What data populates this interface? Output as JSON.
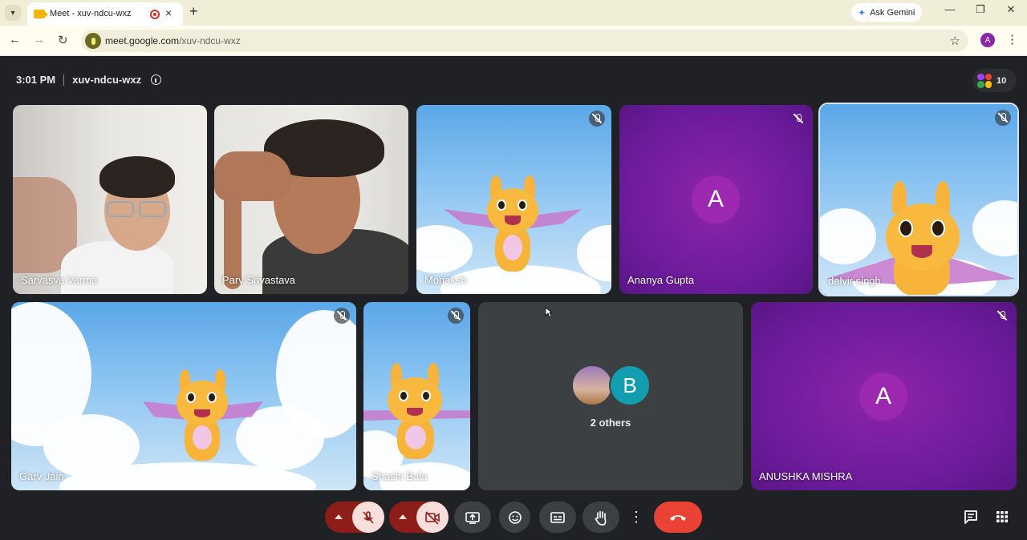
{
  "browser": {
    "tab_title": "Meet - xuv-ndcu-wxz",
    "new_tab": "+",
    "ask_gemini": "Ask Gemini",
    "url_host": "meet.google.com",
    "url_path": "/xuv-ndcu-wxz",
    "profile_initial": "A",
    "window_controls": [
      "—",
      "❐",
      "✕"
    ]
  },
  "meeting": {
    "time": "3:01 PM",
    "code": "xuv-ndcu-wxz",
    "participant_count": "10"
  },
  "tiles": [
    {
      "name": "Sarvasva Varma",
      "type": "camera",
      "muted": false
    },
    {
      "name": "Parv Srivastava",
      "type": "camera",
      "muted": false
    },
    {
      "name": "Monaksh",
      "type": "avatar-dragon",
      "muted": true
    },
    {
      "name": "Ananya Gupta",
      "type": "initial",
      "initial": "A",
      "muted": true
    },
    {
      "name": "dalvir singh",
      "type": "avatar-dragon",
      "muted": true
    },
    {
      "name": "Garv Jain",
      "type": "avatar-dragon",
      "muted": true
    },
    {
      "name": "Shashi Bala",
      "type": "avatar-dragon",
      "muted": true
    },
    {
      "name": "",
      "type": "others",
      "label": "2 others",
      "initial": "B"
    },
    {
      "name": "ANUSHKA MISHRA",
      "type": "initial",
      "initial": "A",
      "muted": true
    }
  ],
  "controls": [
    "mic-options",
    "microphone-off",
    "camera-options",
    "camera-off",
    "present-screen",
    "emoji-reactions",
    "captions",
    "raise-hand",
    "more-options",
    "leave-call"
  ],
  "colors": {
    "meet_bg": "#202124",
    "tile_purple": "#8e24aa",
    "end_call": "#ea4335",
    "muted_control": "#f9dedc",
    "others_avatar": "#129eaf"
  }
}
